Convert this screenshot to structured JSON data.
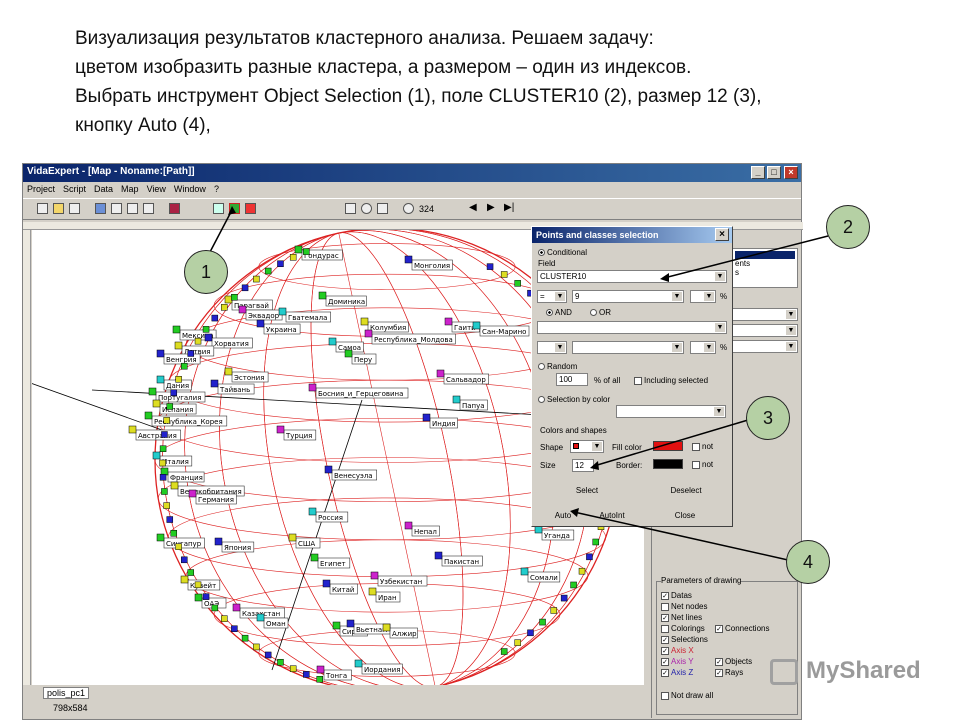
{
  "caption": {
    "line1": "Визуализация результатов кластерного анализа. Решаем задачу:",
    "line2": "цветом изобразить разные кластера, а размером – один из индексов.",
    "line3": "Выбрать инструмент Object Selection (1), поле CLUSTER10 (2), размер 12 (3),",
    "line4": "кнопку Auto (4),"
  },
  "window": {
    "title": "VidaExpert - [Map - Noname:[Path]]",
    "menu": [
      "Project",
      "Script",
      "Data",
      "Map",
      "View",
      "Window",
      "?"
    ],
    "zoom": "324",
    "status_left": "polis_pc1",
    "status_size": "798x584"
  },
  "map_labels": [
    "Гондурас",
    "Монголия",
    "Парагвай",
    "Эквадор",
    "Гватемала",
    "Доминика",
    "Украина",
    "Колумбия",
    "Гаити",
    "Сан-Марино",
    "Мексика",
    "Хорватия",
    "Латвия",
    "Республика_Молдова",
    "Самоа",
    "Перу",
    "Венгрия",
    "Эстония",
    "Сальвадор",
    "Дания",
    "Португалия",
    "Тайвань",
    "Испания",
    "Босния_и_Герцеговина",
    "Папуа",
    "Республика_Корея",
    "Индия",
    "Австралия",
    "Турция",
    "Италия",
    "Франция",
    "Венесуэла",
    "Великобритания",
    "Германия",
    "Россия",
    "Сингапур",
    "Япония",
    "США",
    "Непал",
    "Уганда",
    "Египет",
    "Пакистан",
    "Кувейт",
    "Узбекистан",
    "Сомали",
    "ОАЭ",
    "Китай",
    "Иран",
    "Казахстан",
    "Оман",
    "Сирия",
    "Вьетнам",
    "Алжир",
    "Тонга",
    "Иордания"
  ],
  "panel": {
    "items": [
      "ents",
      "s"
    ],
    "params_title": "Parameters of drawing",
    "params": [
      {
        "label": "Datas",
        "checked": true
      },
      {
        "label": "Net nodes",
        "checked": false
      },
      {
        "label": "Net lines",
        "checked": true
      },
      {
        "label": "Colorings",
        "checked": false
      },
      {
        "label": "Connections",
        "checked": true
      },
      {
        "label": "Selections",
        "checked": true
      },
      {
        "label": "Axis X",
        "checked": true
      },
      {
        "label": "Axis Y",
        "checked": true
      },
      {
        "label": "Objects",
        "checked": true
      },
      {
        "label": "Axis Z",
        "checked": true
      },
      {
        "label": "Rays",
        "checked": true
      },
      {
        "label": "Not draw all",
        "checked": false
      }
    ]
  },
  "dialog": {
    "title": "Points and classes selection",
    "conditional": "Conditional",
    "field_label": "Field",
    "field_value": "CLUSTER10",
    "op1": "=",
    "val1": "9",
    "and": "AND",
    "or": "OR",
    "pct": "%",
    "random": "Random",
    "random_value": "100",
    "pct_of_all": "% of all",
    "including": "Including selected",
    "selection_by_color": "Selection by color",
    "colors_shapes": "Colors and shapes",
    "shape": "Shape",
    "fill_color": "Fill color",
    "not": "not",
    "size": "Size",
    "size_value": "12",
    "border": "Border:",
    "select": "Select",
    "deselect": "Deselect",
    "auto": "Auto",
    "autoint": "AutoInt",
    "close": "Close",
    "fill_hex": "#e01010",
    "border_hex": "#000000"
  },
  "callouts": [
    "1",
    "2",
    "3",
    "4"
  ],
  "watermark": "MyShared"
}
